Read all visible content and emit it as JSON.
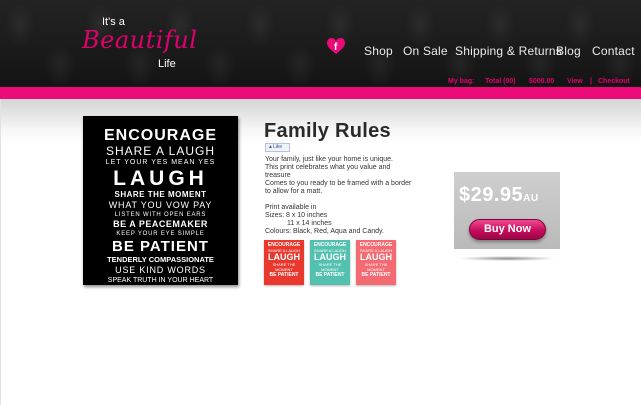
{
  "brand": {
    "line1": "It's a",
    "line2": "Beautiful",
    "line3": "Life"
  },
  "nav": {
    "shop": "Shop",
    "on_sale": "On Sale",
    "shipping": "Shipping & Returns",
    "blog": "Blog",
    "contact": "Contact"
  },
  "bag": {
    "label": "My bag:",
    "total": "Total (00)",
    "amount": "$000.00",
    "view": "View",
    "sep": "|",
    "checkout": "Checkout"
  },
  "icons": {
    "facebook": "facebook-icon"
  },
  "colors": {
    "accent": "#ea0a78",
    "header_bg": "#1b1b1b",
    "price_bg": "#c4c4c4",
    "red": "#e9392f",
    "aqua": "#53c0b0",
    "candy": "#f36a73"
  },
  "product": {
    "title": "Family Rules",
    "like_label": "Like",
    "desc1": "Your family, just like your home is unique.",
    "desc2": "This print celebrates what you value and",
    "desc3": "treasure",
    "desc4": "Comes to you ready to be framed with a border",
    "desc5": "to allow for a matt.",
    "print1": "Print available in",
    "sizes1": "Sizes: 8 x 10 inches",
    "sizes2": "11 x 14 inches",
    "colours": "Colours: Black, Red, Aqua and Candy.",
    "price": "$29.95",
    "currency": "AU",
    "buy_label": "Buy Now"
  },
  "poster": {
    "l1": "ENCOURAGE",
    "l2": "SHARE A LAUGH",
    "l3": "LET YOUR YES MEAN YES",
    "l4": "LAUGH",
    "l5": "SHARE THE MOMENT",
    "l6": "WHAT YOU VOW PAY",
    "l7": "LISTEN WITH OPEN EARS",
    "l8": "BE A PEACEMAKER",
    "l9": "KEEP YOUR EYE SIMPLE",
    "l10": "BE PATIENT",
    "l11": "TENDERLY COMPASSIONATE",
    "l12": "USE KIND WORDS",
    "l13": "SPEAK TRUTH IN YOUR HEART"
  }
}
